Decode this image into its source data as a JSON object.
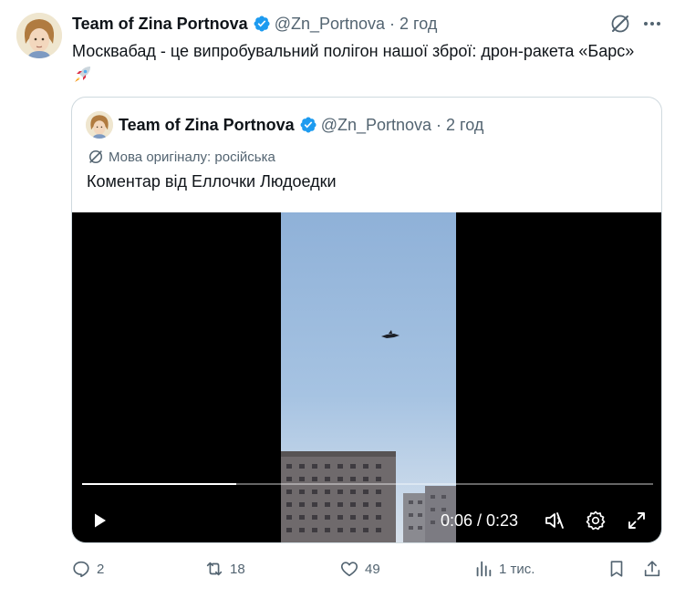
{
  "tweet": {
    "author_name": "Team of Zina Portnova",
    "handle": "@Zn_Portnova",
    "separator": "·",
    "time": "2 год",
    "text": "Москвабад - це випробувальний полігон нашої зброї: дрон-ракета «Барс»",
    "emoji_icon": "rocket-emoji"
  },
  "quoted_tweet": {
    "author_name": "Team of Zina Portnova",
    "handle": "@Zn_Portnova",
    "separator": "·",
    "time": "2 год",
    "translation_note": "Мова оригіналу: російська",
    "text": "Коментар від Еллочки Людоедки"
  },
  "video": {
    "time_display": "0:06 / 0:23",
    "progress": 0.27
  },
  "actions": {
    "replies": "2",
    "reposts": "18",
    "likes": "49",
    "views": "1 тис."
  },
  "colors": {
    "verified": "#1d9bf0",
    "text_primary": "#0f1419",
    "text_secondary": "#536471",
    "border": "#cfd9de"
  }
}
